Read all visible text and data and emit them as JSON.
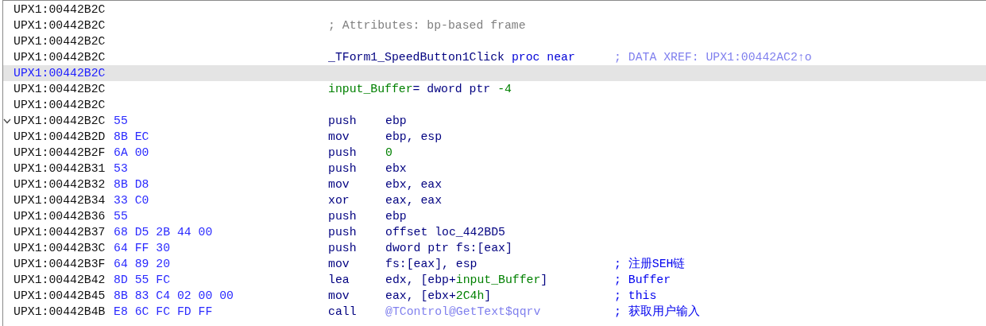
{
  "lines": [
    {
      "address": "UPX1:00442B2C",
      "selected": false
    },
    {
      "address": "UPX1:00442B2C",
      "selected": false,
      "code": [
        {
          "text": "; Attributes: bp-based frame",
          "kind": "comment"
        }
      ]
    },
    {
      "address": "UPX1:00442B2C",
      "selected": false
    },
    {
      "address": "UPX1:00442B2C",
      "selected": false,
      "code": [
        {
          "text": "_TForm1_SpeedButton1Click",
          "kind": "label"
        },
        {
          "text": " proc near",
          "kind": "keyword"
        }
      ],
      "comment": {
        "text": "; DATA XREF: UPX1:00442AC2↑o",
        "kind": "xref"
      }
    },
    {
      "address": "UPX1:00442B2C",
      "selected": true
    },
    {
      "address": "UPX1:00442B2C",
      "selected": false,
      "code": [
        {
          "text": "input_Buffer",
          "kind": "name"
        },
        {
          "text": "= dword ptr ",
          "kind": "plain"
        },
        {
          "text": "-4",
          "kind": "number"
        }
      ]
    },
    {
      "address": "UPX1:00442B2C",
      "selected": false
    },
    {
      "address": "UPX1:00442B2C",
      "selected": false,
      "expanded": true,
      "bytes": "55",
      "mnemonic": "push",
      "operands": [
        {
          "text": "ebp",
          "kind": "plain"
        }
      ]
    },
    {
      "address": "UPX1:00442B2D",
      "selected": false,
      "bytes": "8B EC",
      "mnemonic": "mov",
      "operands": [
        {
          "text": "ebp, esp",
          "kind": "plain"
        }
      ]
    },
    {
      "address": "UPX1:00442B2F",
      "selected": false,
      "bytes": "6A 00",
      "mnemonic": "push",
      "operands": [
        {
          "text": "0",
          "kind": "number"
        }
      ]
    },
    {
      "address": "UPX1:00442B31",
      "selected": false,
      "bytes": "53",
      "mnemonic": "push",
      "operands": [
        {
          "text": "ebx",
          "kind": "plain"
        }
      ]
    },
    {
      "address": "UPX1:00442B32",
      "selected": false,
      "bytes": "8B D8",
      "mnemonic": "mov",
      "operands": [
        {
          "text": "ebx, eax",
          "kind": "plain"
        }
      ]
    },
    {
      "address": "UPX1:00442B34",
      "selected": false,
      "bytes": "33 C0",
      "mnemonic": "xor",
      "operands": [
        {
          "text": "eax, eax",
          "kind": "plain"
        }
      ]
    },
    {
      "address": "UPX1:00442B36",
      "selected": false,
      "bytes": "55",
      "mnemonic": "push",
      "operands": [
        {
          "text": "ebp",
          "kind": "plain"
        }
      ]
    },
    {
      "address": "UPX1:00442B37",
      "selected": false,
      "bytes": "68 D5 2B 44 00",
      "mnemonic": "push",
      "operands": [
        {
          "text": "offset loc_442BD5",
          "kind": "plain"
        }
      ]
    },
    {
      "address": "UPX1:00442B3C",
      "selected": false,
      "bytes": "64 FF 30",
      "mnemonic": "push",
      "operands": [
        {
          "text": "dword ptr fs:[eax]",
          "kind": "plain"
        }
      ]
    },
    {
      "address": "UPX1:00442B3F",
      "selected": false,
      "bytes": "64 89 20",
      "mnemonic": "mov",
      "operands": [
        {
          "text": "fs:[eax], esp",
          "kind": "plain"
        }
      ],
      "comment": {
        "text": "; 注册SEH链",
        "kind": "user"
      }
    },
    {
      "address": "UPX1:00442B42",
      "selected": false,
      "bytes": "8D 55 FC",
      "mnemonic": "lea",
      "operands": [
        {
          "text": "edx, [ebp+",
          "kind": "plain"
        },
        {
          "text": "input_Buffer",
          "kind": "name"
        },
        {
          "text": "]",
          "kind": "plain"
        }
      ],
      "comment": {
        "text": "; Buffer",
        "kind": "user"
      }
    },
    {
      "address": "UPX1:00442B45",
      "selected": false,
      "bytes": "8B 83 C4 02 00 00",
      "mnemonic": "mov",
      "operands": [
        {
          "text": "eax, [ebx+",
          "kind": "plain"
        },
        {
          "text": "2C4h",
          "kind": "number"
        },
        {
          "text": "]",
          "kind": "plain"
        }
      ],
      "comment": {
        "text": "; this",
        "kind": "user"
      }
    },
    {
      "address": "UPX1:00442B4B",
      "selected": false,
      "bytes": "E8 6C FC FD FF",
      "mnemonic": "call",
      "operands": [
        {
          "text": "@TControl@GetText$qqrv",
          "kind": "import"
        }
      ],
      "comment": {
        "text": "; 获取用户输入",
        "kind": "user"
      }
    }
  ]
}
